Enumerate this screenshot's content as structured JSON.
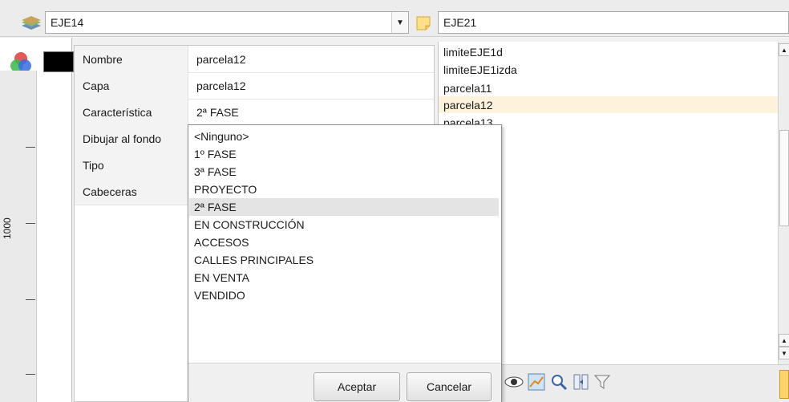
{
  "toolbar": {
    "left_combo_value": "EJE14",
    "right_combo_value": "EJE21"
  },
  "ruler": {
    "label": "1000"
  },
  "properties": [
    {
      "key": "Nombre",
      "value": "parcela12"
    },
    {
      "key": "Capa",
      "value": "parcela12"
    },
    {
      "key": "Característica",
      "value": "2ª FASE"
    },
    {
      "key": "Dibujar al fondo",
      "value": ""
    },
    {
      "key": "Tipo",
      "value": ""
    },
    {
      "key": "Cabeceras",
      "value": ""
    }
  ],
  "dropdown": {
    "options": [
      "<Ninguno>",
      "1º FASE",
      "3ª FASE",
      "PROYECTO",
      "2ª FASE",
      "EN CONSTRUCCIÓN",
      "ACCESOS",
      "CALLES PRINCIPALES",
      "EN VENTA",
      "VENDIDO"
    ],
    "selected": "2ª FASE"
  },
  "buttons": {
    "accept": "Aceptar",
    "cancel": "Cancelar"
  },
  "layer_list": {
    "items": [
      "limiteEJE1d",
      "limiteEJE1izda",
      "parcela11",
      "parcela12",
      "parcela13"
    ],
    "highlighted": "parcela12"
  },
  "colors": {
    "highlight": "#fdf3dc",
    "selected_option": "#e4e4e4",
    "color_swatch": "#000000"
  },
  "icons": [
    "layers-icon",
    "color-wheel-icon",
    "note-icon",
    "eye-icon",
    "chart-icon",
    "zoom-icon",
    "columns-icon",
    "filter-icon"
  ]
}
